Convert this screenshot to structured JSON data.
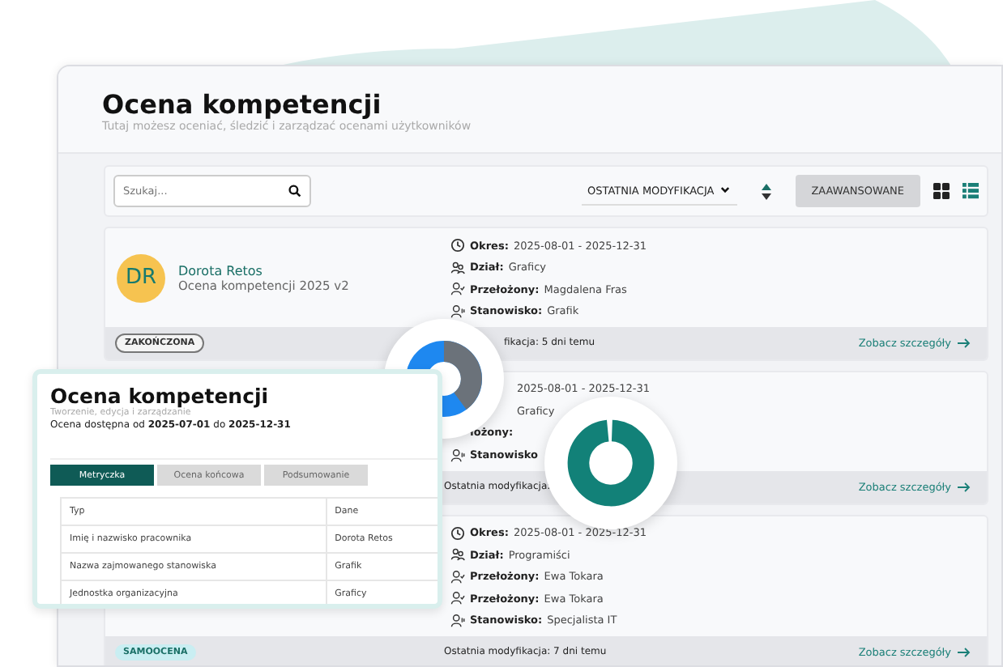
{
  "page": {
    "title": "Ocena kompetencji",
    "subtitle": "Tutaj możesz oceniać, śledzić i zarządzać ocenami użytkowników"
  },
  "toolbar": {
    "search": {
      "placeholder": "Szukaj..."
    },
    "sort": "OSTATNIA MODYFIKACJA",
    "advanced_button": "ZAAWANSOWANE",
    "views": [
      {
        "kind": "grid",
        "selected": false
      },
      {
        "kind": "list",
        "selected": true
      }
    ]
  },
  "cards": [
    {
      "avatar": "DR",
      "name": "Dorota Retos",
      "subtitle": "Ocena kompetencji 2025 v2",
      "details": [
        {
          "kind": "period",
          "label": "Okres:",
          "value": "2025-08-01 - 2025-12-31"
        },
        {
          "kind": "department",
          "label": "Dział:",
          "value": "Graficy"
        },
        {
          "kind": "supervisor",
          "label": "Przełożony:",
          "value": "Magdalena Fras"
        },
        {
          "kind": "position",
          "label": "Stanowisko:",
          "value": "Grafik"
        }
      ],
      "status": {
        "kind": "outline",
        "text": "ZAKOŃCZONA"
      },
      "modified": "fikacja: 5 dni temu",
      "link": "Zobacz szczegóły"
    },
    {
      "details": [
        {
          "value": "2025-08-01 - 2025-12-31"
        },
        {
          "value": "Graficy"
        },
        {
          "label": "łożony:"
        },
        {
          "kind": "position",
          "label": "Stanowisko"
        }
      ],
      "modified": "Ostatnia modyfikacja:",
      "link": "Zobacz szczegóły"
    },
    {
      "details": [
        {
          "kind": "period",
          "label": "Okres:",
          "value": "2025-08-01 - 2025-12-31"
        },
        {
          "kind": "department",
          "label": "Dział:",
          "value": "Programiści"
        },
        {
          "kind": "supervisor",
          "label": "Przełożony:",
          "value": "Ewa Tokara"
        },
        {
          "kind": "supervisor",
          "label": "Przełożony:",
          "value": "Ewa Tokara"
        },
        {
          "kind": "position",
          "label": "Stanowisko:",
          "value": "Specjalista IT"
        }
      ],
      "status": {
        "kind": "filled",
        "text": "SAMOOCENA"
      },
      "modified": "Ostatnia modyfikacja: 7 dni temu",
      "link": "Zobacz szczegóły"
    }
  ],
  "panel": {
    "title": "Ocena kompetencji",
    "subtitle": "Tworzenie, edycja i zarządzanie",
    "availability": "Ocena dostępna od **2025-07-01** do **2025-12-31**",
    "tabs": [
      {
        "label": "Metryczka",
        "selected": true
      },
      {
        "label": "Ocena końcowa",
        "selected": false
      },
      {
        "label": "Podsumowanie",
        "selected": false
      }
    ],
    "table": {
      "columns": [
        "Typ",
        "Dane"
      ],
      "rows": [
        [
          "Imię i nazwisko pracownika",
          "Dorota Retos"
        ],
        [
          "Nazwa zajmowanego stanowiska",
          "Grafik"
        ],
        [
          "Jednostka organizacyjna",
          "Graficy"
        ]
      ]
    }
  }
}
